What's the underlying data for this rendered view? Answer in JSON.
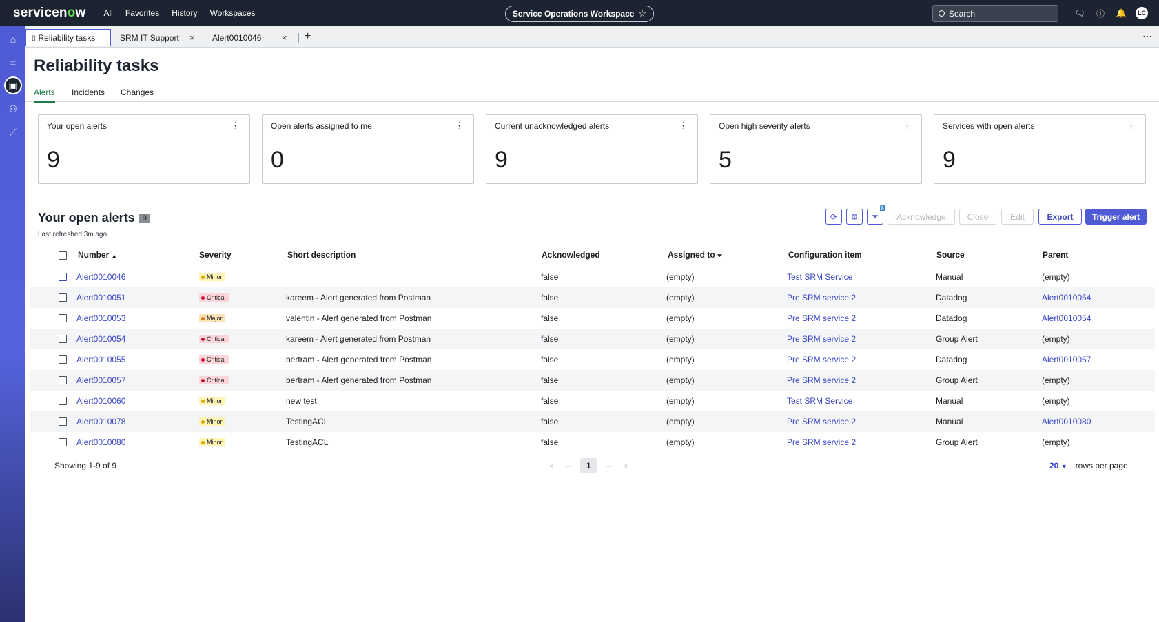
{
  "topbar": {
    "logo_prefix": "servicen",
    "logo_o": "o",
    "logo_suffix": "w",
    "nav": [
      "All",
      "Favorites",
      "History",
      "Workspaces"
    ],
    "workspace": "Service Operations Workspace",
    "search_placeholder": "Search",
    "avatar": "LC"
  },
  "tabs": [
    {
      "label": "Reliability tasks"
    },
    {
      "label": "SRM IT Support"
    },
    {
      "label": "Alert0010046"
    }
  ],
  "page": {
    "title": "Reliability tasks",
    "subtabs": [
      "Alerts",
      "Incidents",
      "Changes"
    ]
  },
  "cards": [
    {
      "title": "Your open alerts",
      "value": "9"
    },
    {
      "title": "Open alerts assigned to me",
      "value": "0"
    },
    {
      "title": "Current unacknowledged alerts",
      "value": "9"
    },
    {
      "title": "Open high severity alerts",
      "value": "5"
    },
    {
      "title": "Services with open alerts",
      "value": "9"
    }
  ],
  "list": {
    "title": "Your open alerts",
    "count": "9",
    "refreshed": "Last refreshed 3m ago",
    "filter_count": "8",
    "buttons": {
      "acknowledge": "Acknowledge",
      "close": "Close",
      "edit": "Edit",
      "export": "Export",
      "trigger": "Trigger alert"
    },
    "columns": [
      "Number",
      "Severity",
      "Short description",
      "Acknowledged",
      "Assigned to",
      "Configuration item",
      "Source",
      "Parent"
    ],
    "rows": [
      {
        "number": "Alert0010046",
        "severity": "Minor",
        "desc": "",
        "ack": "false",
        "assigned": "(empty)",
        "ci": "Test SRM Service",
        "source": "Manual",
        "parent": "(empty)"
      },
      {
        "number": "Alert0010051",
        "severity": "Critical",
        "desc": "kareem - Alert generated from Postman",
        "ack": "false",
        "assigned": "(empty)",
        "ci": "Pre SRM service 2",
        "source": "Datadog",
        "parent": "Alert0010054"
      },
      {
        "number": "Alert0010053",
        "severity": "Major",
        "desc": "valentin - Alert generated from Postman",
        "ack": "false",
        "assigned": "(empty)",
        "ci": "Pre SRM service 2",
        "source": "Datadog",
        "parent": "Alert0010054"
      },
      {
        "number": "Alert0010054",
        "severity": "Critical",
        "desc": "kareem - Alert generated from Postman",
        "ack": "false",
        "assigned": "(empty)",
        "ci": "Pre SRM service 2",
        "source": "Group Alert",
        "parent": "(empty)"
      },
      {
        "number": "Alert0010055",
        "severity": "Critical",
        "desc": "bertram - Alert generated from Postman",
        "ack": "false",
        "assigned": "(empty)",
        "ci": "Pre SRM service 2",
        "source": "Datadog",
        "parent": "Alert0010057"
      },
      {
        "number": "Alert0010057",
        "severity": "Critical",
        "desc": "bertram - Alert generated from Postman",
        "ack": "false",
        "assigned": "(empty)",
        "ci": "Pre SRM service 2",
        "source": "Group Alert",
        "parent": "(empty)"
      },
      {
        "number": "Alert0010060",
        "severity": "Minor",
        "desc": "new test",
        "ack": "false",
        "assigned": "(empty)",
        "ci": "Test SRM Service",
        "source": "Manual",
        "parent": "(empty)"
      },
      {
        "number": "Alert0010078",
        "severity": "Minor",
        "desc": "TestingACL",
        "ack": "false",
        "assigned": "(empty)",
        "ci": "Pre SRM service 2",
        "source": "Manual",
        "parent": "Alert0010080"
      },
      {
        "number": "Alert0010080",
        "severity": "Minor",
        "desc": "TestingACL",
        "ack": "false",
        "assigned": "(empty)",
        "ci": "Pre SRM service 2",
        "source": "Group Alert",
        "parent": "(empty)"
      }
    ],
    "footer": {
      "showing": "Showing 1-9 of 9",
      "page": "1",
      "rows_per_page": "20",
      "rows_per_page_label": "rows per page"
    }
  }
}
